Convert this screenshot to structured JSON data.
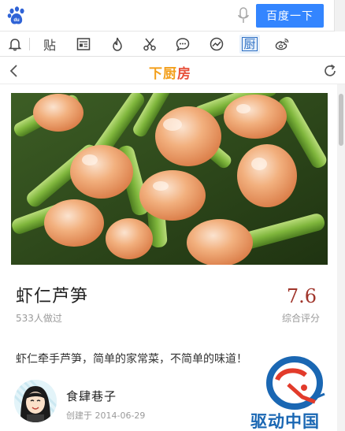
{
  "search": {
    "button_label": "百度一下"
  },
  "toolbar": {
    "icons": [
      "bell-icon",
      "tieba-icon",
      "news-icon",
      "fire-icon",
      "scissors-icon",
      "chat-icon",
      "trend-icon",
      "kitchen-icon",
      "weibo-icon"
    ],
    "active": "kitchen-icon",
    "active_glyph": "厨",
    "tieba_glyph": "贴"
  },
  "nav": {
    "brand_part1": "下厨",
    "brand_part2": "房"
  },
  "recipe": {
    "title": "虾仁芦笋",
    "made_count": "533人做过",
    "score": "7.6",
    "score_label": "综合评分",
    "description": "虾仁牵手芦笋，简单的家常菜，不简单的味道！"
  },
  "author": {
    "name": "食肆巷子",
    "created": "创建于 2014-06-29"
  },
  "watermark": {
    "text": "驱动中国"
  },
  "colors": {
    "accent": "#3385ff",
    "score": "#a0352b",
    "brand": "#e8513b",
    "brand_alt": "#f3a01d"
  }
}
